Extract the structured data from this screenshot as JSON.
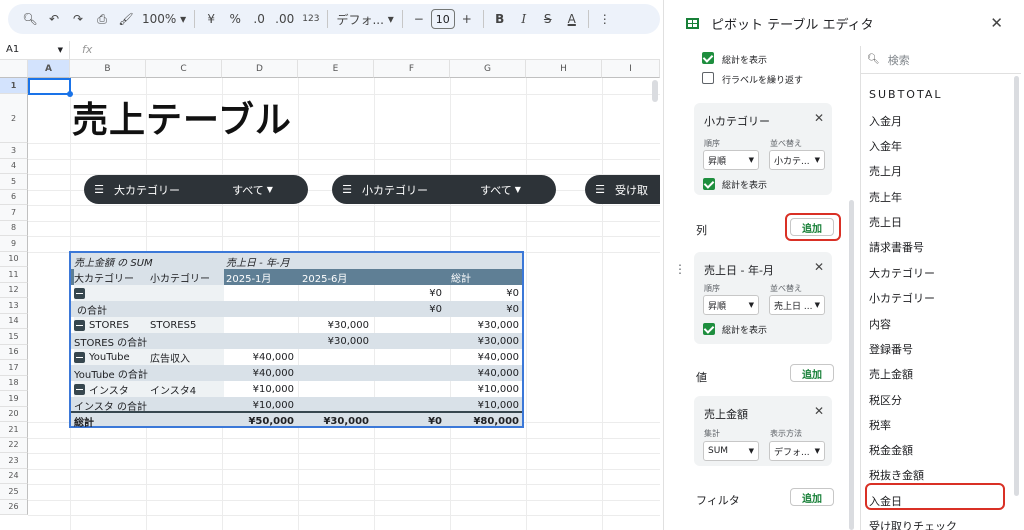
{
  "toolbar": {
    "zoom": "100%",
    "currency": "¥",
    "percent": "%",
    "dec_decrease": ".0",
    "dec_increase": ".00",
    "number_format": "123",
    "font": "デフォ...",
    "font_size": "10"
  },
  "formula_bar": {
    "cell_ref": "A1",
    "fx": "fx"
  },
  "columns": [
    "A",
    "B",
    "C",
    "D",
    "E",
    "F",
    "G",
    "H",
    "I"
  ],
  "rows": [
    "1",
    "2",
    "3",
    "4",
    "5",
    "6",
    "7",
    "8",
    "9",
    "10",
    "11",
    "12",
    "13",
    "14",
    "15",
    "16",
    "17",
    "18",
    "19",
    "20",
    "21",
    "22",
    "23",
    "24",
    "25",
    "26"
  ],
  "sheet": {
    "title": "売上テーブル",
    "filters": [
      {
        "label": "大カテゴリー",
        "value": "すべて"
      },
      {
        "label": "小カテゴリー",
        "value": "すべて"
      },
      {
        "label": "受け取"
      }
    ]
  },
  "pivot_table": {
    "values_label": "売上金額 の SUM",
    "column_field": "売上日 - 年-月",
    "row_header_1": "大カテゴリー",
    "row_header_2": "小カテゴリー",
    "col_2025_01": "2025-1月",
    "col_2025_06": "2025-6月",
    "col_total": "総計",
    "rows": [
      {
        "cat": "",
        "sub": "",
        "d": "",
        "e": "",
        "f": "¥0",
        "g": "¥0",
        "expand": true
      },
      {
        "cat": "の合計",
        "sub": "",
        "d": "",
        "e": "",
        "f": "¥0",
        "g": "¥0",
        "subtotal": true
      },
      {
        "cat": "STORES",
        "sub": "STORES5",
        "d": "",
        "e": "¥30,000",
        "f": "",
        "g": "¥30,000",
        "expand": true
      },
      {
        "cat": "STORES の合計",
        "sub": "",
        "d": "",
        "e": "¥30,000",
        "f": "",
        "g": "¥30,000",
        "subtotal": true
      },
      {
        "cat": "YouTube",
        "sub": "広告収入",
        "d": "¥40,000",
        "e": "",
        "f": "",
        "g": "¥40,000",
        "expand": true
      },
      {
        "cat": "YouTube の合計",
        "sub": "",
        "d": "¥40,000",
        "e": "",
        "f": "",
        "g": "¥40,000",
        "subtotal": true
      },
      {
        "cat": "インスタ",
        "sub": "インスタ4",
        "d": "¥10,000",
        "e": "",
        "f": "",
        "g": "¥10,000",
        "expand": true
      },
      {
        "cat": "インスタ の合計",
        "sub": "",
        "d": "¥10,000",
        "e": "",
        "f": "",
        "g": "¥10,000",
        "subtotal": true
      }
    ],
    "grand_total": {
      "label": "総計",
      "d": "¥50,000",
      "e": "¥30,000",
      "f": "¥0",
      "g": "¥80,000"
    }
  },
  "editor": {
    "title": "ピボット テーブル エディタ",
    "top_checks": [
      {
        "label": "総計を表示",
        "checked": true
      },
      {
        "label": "行ラベルを繰り返す",
        "checked": false
      }
    ],
    "row_card": {
      "title": "小カテゴリー",
      "order_label": "順序",
      "order_value": "昇順",
      "sort_label": "並べ替え",
      "sort_value": "小カテ...",
      "show_total": "総計を表示"
    },
    "columns_section": {
      "label": "列",
      "add": "追加"
    },
    "column_card": {
      "title": "売上日 - 年-月",
      "order_label": "順序",
      "order_value": "昇順",
      "sort_label": "並べ替え",
      "sort_value": "売上日 ...",
      "show_total": "総計を表示"
    },
    "values_section": {
      "label": "値",
      "add": "追加"
    },
    "value_card": {
      "title": "売上金額",
      "agg_label": "集計",
      "agg_value": "SUM",
      "display_label": "表示方法",
      "display_value": "デフォ..."
    },
    "filter_section": {
      "label": "フィルタ",
      "add": "追加"
    },
    "search_placeholder": "検索",
    "fields": [
      "SUBTOTAL",
      "入金月",
      "入金年",
      "売上月",
      "売上年",
      "売上日",
      "請求書番号",
      "大カテゴリー",
      "小カテゴリー",
      "内容",
      "登録番号",
      "売上金額",
      "税区分",
      "税率",
      "税金金額",
      "税抜き金額",
      "入金日",
      "受け取りチェック"
    ]
  },
  "colors": {
    "accent_green": "#1e8e3e",
    "highlight_red": "#d93025",
    "pivot_header": "#5f7f95",
    "selection_blue": "#3b78d8"
  }
}
